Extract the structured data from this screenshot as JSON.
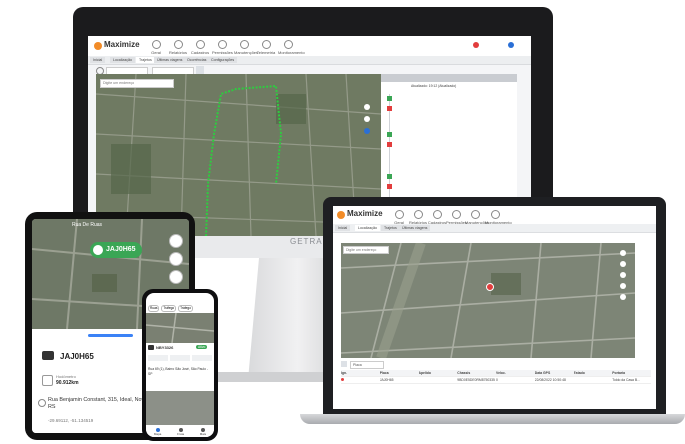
{
  "monitor": {
    "logo": "Maximize",
    "nav": [
      "Geral",
      "Relatórios",
      "Cadastros",
      "Permissões",
      "Manutenções",
      "Telemetria",
      "Monitoramento"
    ],
    "tabs": [
      "Inicial",
      "Localização",
      "Trajetos",
      "Últimas viagens",
      "Ocorrências",
      "Configurações"
    ],
    "map_search_placeholder": "Digite um endereço",
    "side_title": "Atualizado: 19:12 (Atualizado)",
    "brand": "GETRAK"
  },
  "tablet": {
    "header": "Rua De Ruas",
    "badge_plate": "JAJ0H65",
    "plate": "JAJ0H65",
    "hodometer_label": "Hodômetro",
    "hodometer_value": "90.912km",
    "address": "Rua Benjamin Constant, 315, Ideal, Novo Hamburgo - RS",
    "coords": "-29.69112, -51.134519"
  },
  "phone": {
    "chips": [
      "Ruas",
      "Tráfego",
      "Tráfego"
    ],
    "plate": "NBY3326",
    "status": "Ativo",
    "address": "Rua 69 (1), Bairro São José, São Paulo - SP",
    "nav": [
      "Mapa",
      "Frota",
      "Mais"
    ]
  },
  "laptop": {
    "logo": "Maximize",
    "nav": [
      "Geral",
      "Relatórios",
      "Cadastros",
      "Permissões",
      "Manutenções",
      "Monitoramento"
    ],
    "tabs": [
      "Inicial",
      "Localização",
      "Trajetos",
      "Últimas viagens"
    ],
    "map_search_placeholder": "Digite um endereço",
    "table_headers": [
      "Ign.",
      "Placa",
      "Apelido",
      "Chassis",
      "Veloc.",
      "Data GPS",
      "Estado",
      "Portaria"
    ],
    "table_row": [
      "",
      "JAJ0H65",
      "",
      "9BD0E5DE0RM8750335",
      "0",
      "22/08/2022 10:50:48",
      "",
      "Toldo da Casa B..."
    ],
    "filter_label": "Placa"
  },
  "colors": {
    "accent": "#f28c28",
    "green": "#3aa655",
    "route": "#2ecc40",
    "blue": "#3b82f6"
  }
}
